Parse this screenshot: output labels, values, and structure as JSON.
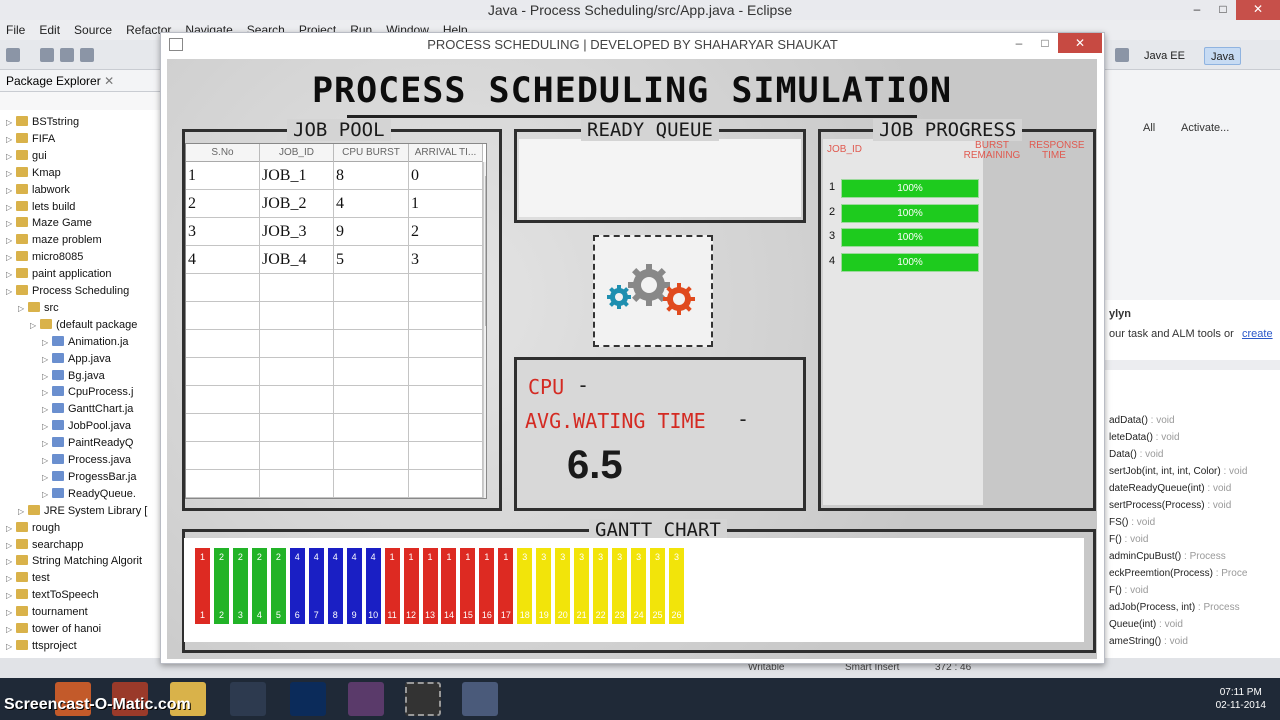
{
  "eclipse": {
    "title": "Java - Process Scheduling/src/App.java - Eclipse",
    "menu": [
      "File",
      "Edit",
      "Source",
      "Refactor",
      "Navigate",
      "Search",
      "Project",
      "Run",
      "Window",
      "Help"
    ],
    "perspectives": [
      "Java EE",
      "Java"
    ],
    "package_explorer_title": "Package Explorer",
    "tree": [
      {
        "label": "BSTstring",
        "level": 0,
        "type": "project"
      },
      {
        "label": "FIFA",
        "level": 0,
        "type": "project"
      },
      {
        "label": "gui",
        "level": 0,
        "type": "project"
      },
      {
        "label": "Kmap",
        "level": 0,
        "type": "project"
      },
      {
        "label": "labwork",
        "level": 0,
        "type": "project"
      },
      {
        "label": "lets build",
        "level": 0,
        "type": "project"
      },
      {
        "label": "Maze Game",
        "level": 0,
        "type": "project"
      },
      {
        "label": "maze problem",
        "level": 0,
        "type": "project"
      },
      {
        "label": "micro8085",
        "level": 0,
        "type": "project"
      },
      {
        "label": "paint application",
        "level": 0,
        "type": "project"
      },
      {
        "label": "Process Scheduling",
        "level": 0,
        "type": "project"
      },
      {
        "label": "src",
        "level": 1,
        "type": "folder"
      },
      {
        "label": "(default package",
        "level": 2,
        "type": "folder"
      },
      {
        "label": "Animation.ja",
        "level": 3,
        "type": "java"
      },
      {
        "label": "App.java",
        "level": 3,
        "type": "java"
      },
      {
        "label": "Bg.java",
        "level": 3,
        "type": "java"
      },
      {
        "label": "CpuProcess.j",
        "level": 3,
        "type": "java"
      },
      {
        "label": "GanttChart.ja",
        "level": 3,
        "type": "java"
      },
      {
        "label": "JobPool.java",
        "level": 3,
        "type": "java"
      },
      {
        "label": "PaintReadyQ",
        "level": 3,
        "type": "java"
      },
      {
        "label": "Process.java",
        "level": 3,
        "type": "java"
      },
      {
        "label": "ProgessBar.ja",
        "level": 3,
        "type": "java"
      },
      {
        "label": "ReadyQueue.",
        "level": 3,
        "type": "java"
      },
      {
        "label": "JRE System Library [",
        "level": 1,
        "type": "folder"
      },
      {
        "label": "rough",
        "level": 0,
        "type": "project"
      },
      {
        "label": "searchapp",
        "level": 0,
        "type": "project"
      },
      {
        "label": "String Matching Algorit",
        "level": 0,
        "type": "project"
      },
      {
        "label": "test",
        "level": 0,
        "type": "project"
      },
      {
        "label": "textToSpeech",
        "level": 0,
        "type": "project"
      },
      {
        "label": "tournament",
        "level": 0,
        "type": "project"
      },
      {
        "label": "tower of hanoi",
        "level": 0,
        "type": "project"
      },
      {
        "label": "ttsproject",
        "level": 0,
        "type": "project"
      }
    ],
    "right_top": {
      "all": "All",
      "activate": "Activate..."
    },
    "mylyn": {
      "title": "ylyn",
      "text": "our task and ALM tools or",
      "link": "create"
    },
    "outline": [
      {
        "name": "adData()",
        "type": " : void"
      },
      {
        "name": "leteData()",
        "type": " : void"
      },
      {
        "name": "Data()",
        "type": " : void"
      },
      {
        "name": "sertJob(int, int, int, Color)",
        "type": " : void"
      },
      {
        "name": "dateReadyQueue(int)",
        "type": " : void"
      },
      {
        "name": "sertProcess(Process)",
        "type": " : void"
      },
      {
        "name": "FS()",
        "type": " : void"
      },
      {
        "name": "F()",
        "type": " : void"
      },
      {
        "name": "adminCpuBust()",
        "type": " : Process"
      },
      {
        "name": "eckPreemtion(Process)",
        "type": " : Proce"
      },
      {
        "name": "F()",
        "type": " : void"
      },
      {
        "name": "adJob(Process, int)",
        "type": " : Process"
      },
      {
        "name": "Queue(int)",
        "type": " : void"
      },
      {
        "name": "ameString()",
        "type": " : void"
      }
    ],
    "status": {
      "writable": "Writable",
      "insert": "Smart Insert",
      "pos": "372 : 46"
    },
    "clock": {
      "time": "07:11 PM",
      "date": "02-11-2014"
    },
    "watermark": "Screencast-O-Matic.com"
  },
  "app": {
    "window_title": "PROCESS SCHEDULING | DEVELOPED BY SHAHARYAR SHAUKAT",
    "main_title": "PROCESS SCHEDULING SIMULATION",
    "job_pool": {
      "title": "JOB POOL",
      "columns": [
        "S.No",
        "JOB_ID",
        "CPU BURST",
        "ARRIVAL TI..."
      ],
      "rows": [
        [
          "1",
          "JOB_1",
          "8",
          "0"
        ],
        [
          "2",
          "JOB_2",
          "4",
          "1"
        ],
        [
          "3",
          "JOB_3",
          "9",
          "2"
        ],
        [
          "4",
          "JOB_4",
          "5",
          "3"
        ]
      ]
    },
    "ready_queue": {
      "title": "READY QUEUE"
    },
    "cpu": {
      "cpu_label": "CPU",
      "avg_label": "AVG.WATING TIME",
      "dash": "-",
      "avg_value": "6.5"
    },
    "job_progress": {
      "title": "JOB PROGRESS",
      "headers": {
        "job_id": "JOB_ID",
        "burst": "BURST REMAINING",
        "response": "RESPONSE TIME"
      },
      "rows": [
        {
          "num": "1",
          "label": "100%",
          "progress": 1.0
        },
        {
          "num": "2",
          "label": "100%",
          "progress": 1.0
        },
        {
          "num": "3",
          "label": "100%",
          "progress": 1.0
        },
        {
          "num": "4",
          "label": "100%",
          "progress": 1.0
        }
      ]
    },
    "gantt": {
      "title": "GANTT CHART",
      "colors": {
        "1": "#dd2a22",
        "2": "#22b327",
        "3": "#f2e40a",
        "4": "#1a1fc4"
      },
      "slots": [
        {
          "job": "1",
          "top": "1",
          "bottom": "1"
        },
        {
          "job": "2",
          "top": "2",
          "bottom": "2"
        },
        {
          "job": "2",
          "top": "2",
          "bottom": "3"
        },
        {
          "job": "2",
          "top": "2",
          "bottom": "4"
        },
        {
          "job": "2",
          "top": "2",
          "bottom": "5"
        },
        {
          "job": "4",
          "top": "4",
          "bottom": "6"
        },
        {
          "job": "4",
          "top": "4",
          "bottom": "7"
        },
        {
          "job": "4",
          "top": "4",
          "bottom": "8"
        },
        {
          "job": "4",
          "top": "4",
          "bottom": "9"
        },
        {
          "job": "4",
          "top": "4",
          "bottom": "10"
        },
        {
          "job": "1",
          "top": "1",
          "bottom": "11"
        },
        {
          "job": "1",
          "top": "1",
          "bottom": "12"
        },
        {
          "job": "1",
          "top": "1",
          "bottom": "13"
        },
        {
          "job": "1",
          "top": "1",
          "bottom": "14"
        },
        {
          "job": "1",
          "top": "1",
          "bottom": "15"
        },
        {
          "job": "1",
          "top": "1",
          "bottom": "16"
        },
        {
          "job": "1",
          "top": "1",
          "bottom": "17"
        },
        {
          "job": "3",
          "top": "3",
          "bottom": "18"
        },
        {
          "job": "3",
          "top": "3",
          "bottom": "19"
        },
        {
          "job": "3",
          "top": "3",
          "bottom": "20"
        },
        {
          "job": "3",
          "top": "3",
          "bottom": "21"
        },
        {
          "job": "3",
          "top": "3",
          "bottom": "22"
        },
        {
          "job": "3",
          "top": "3",
          "bottom": "23"
        },
        {
          "job": "3",
          "top": "3",
          "bottom": "24"
        },
        {
          "job": "3",
          "top": "3",
          "bottom": "25"
        },
        {
          "job": "3",
          "top": "3",
          "bottom": "26"
        }
      ]
    }
  }
}
